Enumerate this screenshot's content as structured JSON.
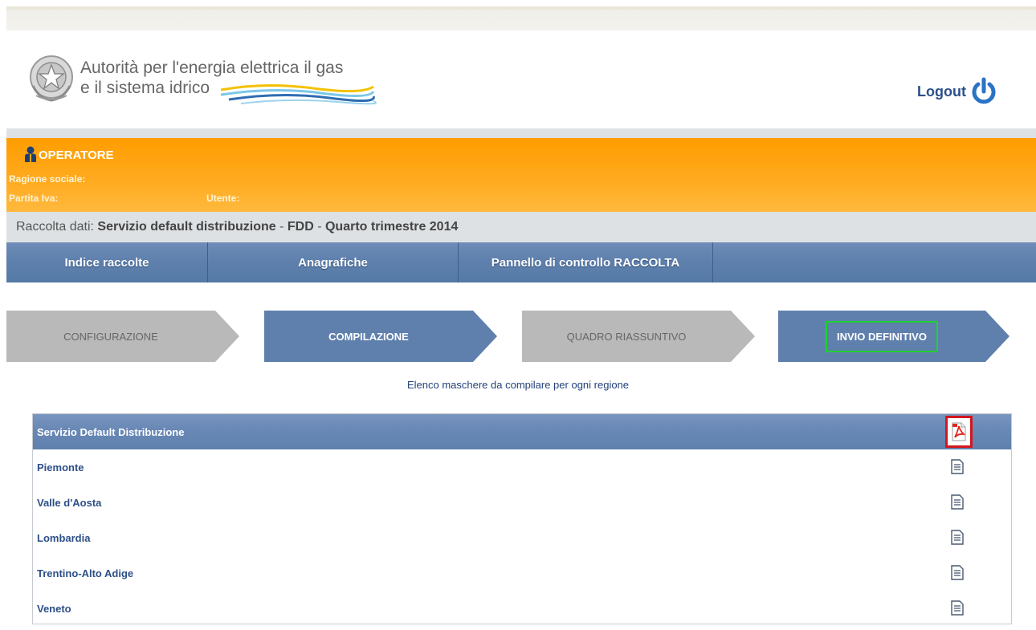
{
  "header": {
    "org_name": "Autorità per l'energia elettrica il gas\ne il sistema idrico",
    "logout_label": "Logout"
  },
  "operator": {
    "title": "OPERATORE",
    "ragione_sociale_label": "Ragione sociale:",
    "partita_iva_label": "Partita Iva:",
    "utente_label": "Utente:"
  },
  "raccolta": {
    "label": "Raccolta dati:",
    "name": "Servizio default distribuzione",
    "sep": " - ",
    "code": "FDD",
    "sep2": " - ",
    "period": "Quarto trimestre 2014"
  },
  "nav": {
    "items": [
      {
        "label": "Indice raccolte"
      },
      {
        "label": "Anagrafiche"
      },
      {
        "label": "Pannello di controllo RACCOLTA"
      },
      {
        "label": ""
      }
    ]
  },
  "steps": [
    {
      "label": "CONFIGURAZIONE",
      "state": "inactive"
    },
    {
      "label": "COMPILAZIONE",
      "state": "active"
    },
    {
      "label": "QUADRO RIASSUNTIVO",
      "state": "inactive"
    },
    {
      "label": "INVIO DEFINITIVO",
      "state": "active",
      "highlighted": true
    }
  ],
  "elenco_text": "Elenco maschere da compilare per ogni regione",
  "table": {
    "header": "Servizio Default Distribuzione",
    "rows": [
      {
        "label": "Piemonte"
      },
      {
        "label": "Valle d'Aosta"
      },
      {
        "label": "Lombardia"
      },
      {
        "label": "Trentino-Alto Adige"
      },
      {
        "label": "Veneto"
      }
    ]
  },
  "colors": {
    "orange": "#ff9d00",
    "nav_blue": "#5f80ad",
    "highlight_green": "#1ed12f",
    "highlight_red": "#d4161c"
  }
}
